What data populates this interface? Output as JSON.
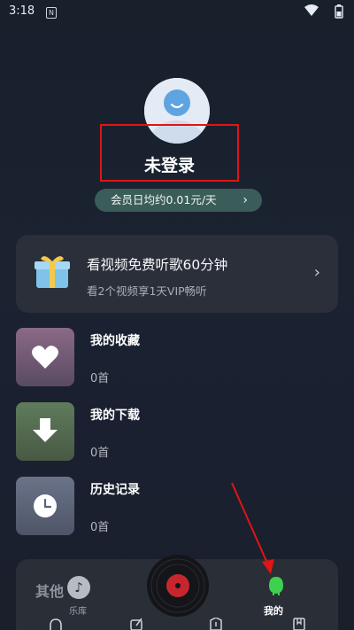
{
  "status_bar": {
    "time": "3:18",
    "notification_glyph": "N",
    "wifi_icon": "wifi-icon",
    "battery_icon": "battery-icon"
  },
  "profile": {
    "login_label": "未登录",
    "vip_pill": "会员日均约0.01元/天",
    "vip_chevron": "›"
  },
  "promo": {
    "title": "看视频免费听歌60分钟",
    "subtitle": "看2个视频享1天VIP畅听",
    "chevron": "›"
  },
  "list": [
    {
      "name": "我的收藏",
      "count": "0首",
      "icon": "heart-icon",
      "color_top": "#8a6a86",
      "color_bottom": "#5c4a64"
    },
    {
      "name": "我的下载",
      "count": "0首",
      "icon": "download-icon",
      "color_top": "#5f7a5b",
      "color_bottom": "#4a5a45"
    },
    {
      "name": "历史记录",
      "count": "0首",
      "icon": "clock-icon",
      "color_top": "#6a7288",
      "color_bottom": "#4e5566"
    }
  ],
  "bottom_nav": {
    "other_label": "其他",
    "library_label": "乐库",
    "me_label": "我的"
  },
  "colors": {
    "accent_green": "#3ed14f",
    "highlight_red": "#e01515",
    "vip_pill_bg": "#3a5d5a"
  }
}
